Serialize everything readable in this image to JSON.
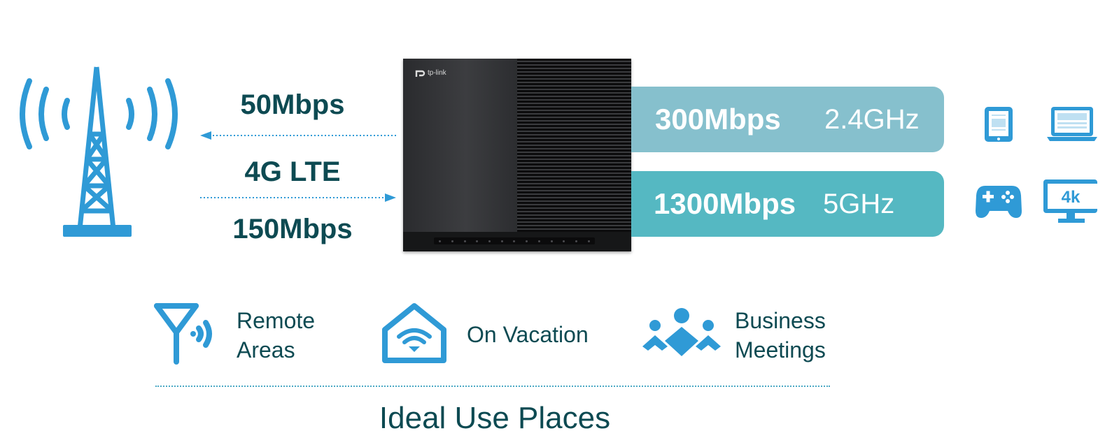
{
  "connection": {
    "download_speed": "50Mbps",
    "technology": "4G LTE",
    "upload_speed": "150Mbps"
  },
  "router": {
    "brand": "tp-link"
  },
  "bands": [
    {
      "speed": "300Mbps",
      "frequency": "2.4GHz",
      "color": "#86c0cd"
    },
    {
      "speed": "1300Mbps",
      "frequency": "5GHz",
      "color": "#55b8c2"
    }
  ],
  "devices": {
    "icons": [
      "tablet-icon",
      "laptop-icon",
      "gamepad-icon",
      "monitor-4k-icon"
    ],
    "monitor_badge": "4k"
  },
  "places": {
    "title": "Ideal Use Places",
    "items": [
      {
        "icon": "antenna-signal-icon",
        "line1": "Remote",
        "line2": "Areas"
      },
      {
        "icon": "house-wifi-icon",
        "line1": "On Vacation"
      },
      {
        "icon": "people-group-icon",
        "line1": "Business",
        "line2": "Meetings"
      }
    ]
  },
  "colors": {
    "accent_blue": "#2f9ad6",
    "text_dark_teal": "#0d4a52"
  }
}
